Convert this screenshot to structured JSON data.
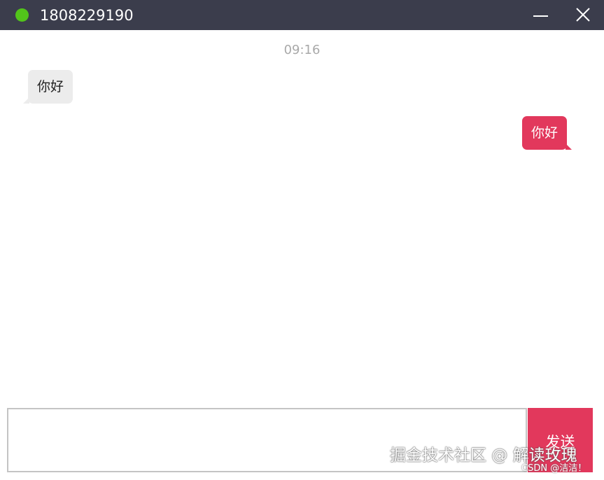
{
  "window": {
    "title": "1808229190",
    "status": "online",
    "status_color": "#52c41a",
    "titlebar_color": "#3b3d4c",
    "minimize_icon": "minimize-icon",
    "close_icon": "close-icon"
  },
  "chat": {
    "timestamp": "09:16",
    "messages": [
      {
        "direction": "incoming",
        "text": "你好",
        "bubble_color": "#ececec"
      },
      {
        "direction": "outgoing",
        "text": "你好",
        "bubble_color": "#e2385c"
      }
    ]
  },
  "composer": {
    "input_value": "",
    "send_label": "发送",
    "accent_color": "#e2385c"
  },
  "watermark": {
    "main": "掘金技术社区 @ 解读玫瑰",
    "small": "CSDN @洁洁！"
  }
}
